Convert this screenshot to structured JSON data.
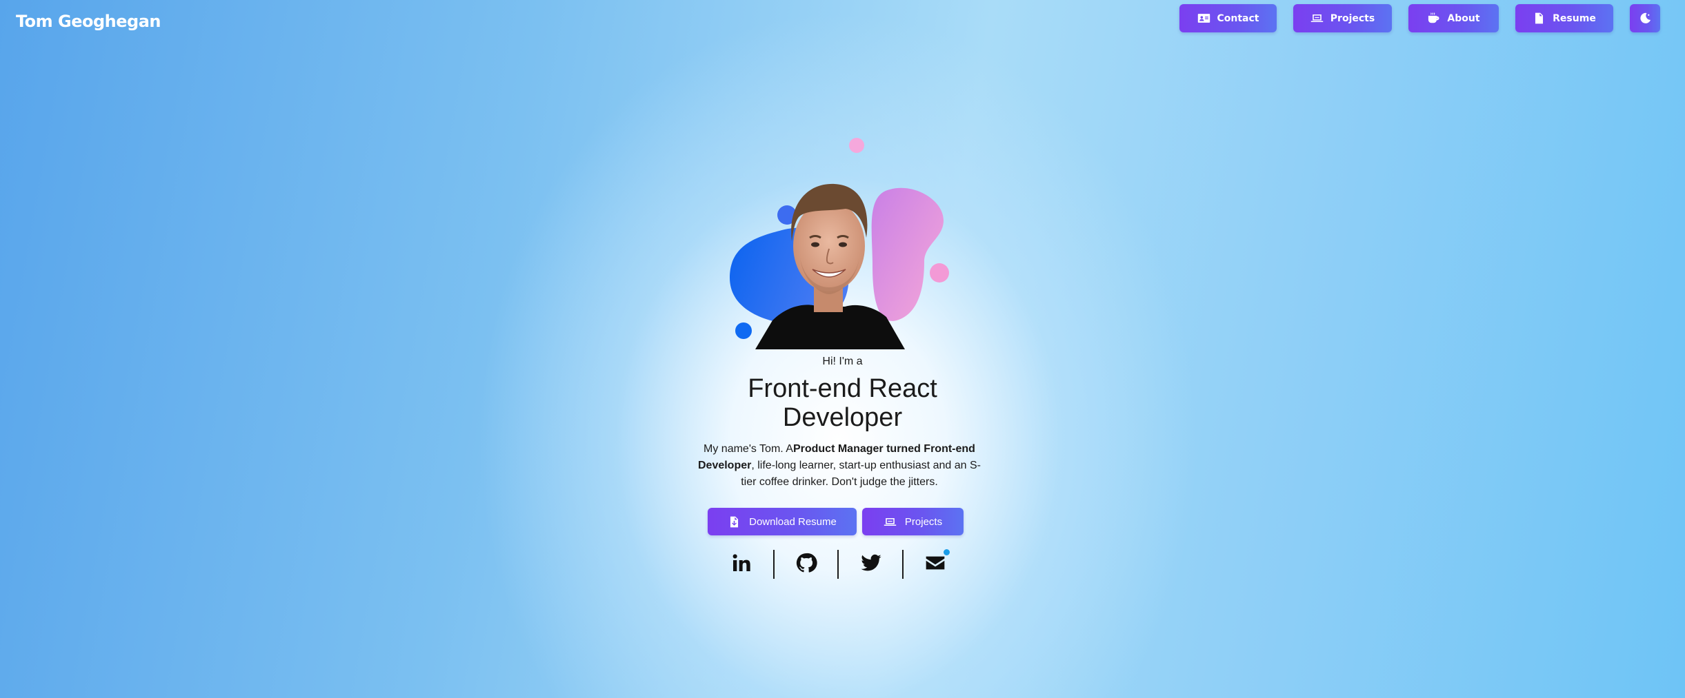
{
  "brand": {
    "name": "Tom Geoghegan"
  },
  "nav": {
    "items": [
      {
        "label": "Contact",
        "icon": "contact-card-icon"
      },
      {
        "label": "Projects",
        "icon": "laptop-icon"
      },
      {
        "label": "About",
        "icon": "coffee-icon"
      },
      {
        "label": "Resume",
        "icon": "document-icon"
      }
    ],
    "theme_toggle_icon": "moon-icon"
  },
  "hero": {
    "intro": "Hi! I'm a",
    "role_line1": "Front-end React",
    "role_line2": "Developer",
    "bio_prefix": "My name's Tom. A",
    "bio_bold": "Product Manager turned Front-end Developer",
    "bio_suffix": ", life-long learner, start-up enthusiast and an S-tier coffee drinker. Don't judge the jitters."
  },
  "actions": {
    "download_label": "Download Resume",
    "projects_label": "Projects"
  },
  "social": [
    "linkedin-icon",
    "github-icon",
    "twitter-icon",
    "envelope-icon"
  ],
  "colors": {
    "button_gradient_start": "#7b3ff0",
    "button_gradient_end": "#5c73f2",
    "blob_blue": "#0f6af2",
    "blob_pink": "#f39ad6",
    "notification_dot": "#1a9ce8"
  }
}
